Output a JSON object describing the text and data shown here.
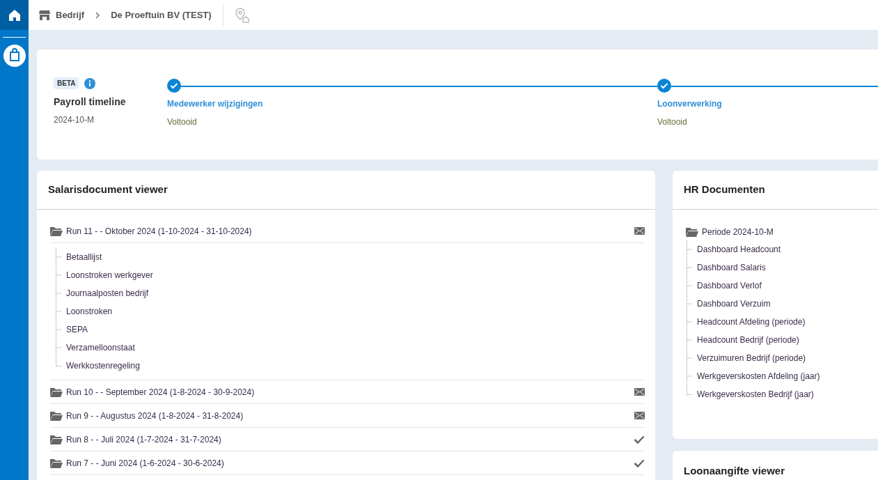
{
  "sidebar": {
    "items": [
      {
        "selected": true
      },
      {
        "selected": false
      }
    ]
  },
  "breadcrumb": [
    "Bedrijf",
    "De Proeftuin BV (TEST)"
  ],
  "timeline": {
    "badge": "BETA",
    "title": "Payroll timeline",
    "period": "2024-10-M",
    "steps": [
      {
        "label": "Medewerker wijzigingen",
        "status": "Voltooid",
        "done": true
      },
      {
        "label": "Loonverwerking",
        "status": "Voltooid",
        "done": true
      }
    ]
  },
  "salary_viewer": {
    "title": "Salarisdocument viewer",
    "runs": [
      {
        "label": "Run 11 - - Oktober 2024 (1-10-2024 - 31-10-2024)",
        "kind": "mail",
        "children": [
          "Betaallijst",
          "Loonstroken werkgever",
          "Journaalposten bedrijf",
          "Loonstroken",
          "SEPA",
          "Verzamelloonstaat",
          "Werkkostenregeling"
        ]
      },
      {
        "label": "Run 10 - - September 2024 (1-8-2024 - 30-9-2024)",
        "kind": "mail"
      },
      {
        "label": "Run 9 - - Augustus 2024 (1-8-2024 - 31-8-2024)",
        "kind": "mail"
      },
      {
        "label": "Run 8 - - Juli 2024 (1-7-2024 - 31-7-2024)",
        "kind": "check"
      },
      {
        "label": "Run 7 - - Juni 2024 (1-6-2024 - 30-6-2024)",
        "kind": "check"
      }
    ]
  },
  "hr_documents": {
    "title": "HR Documenten",
    "folder": "Periode 2024-10-M",
    "children": [
      "Dashboard Headcount",
      "Dashboard Salaris",
      "Dashboard Verlof",
      "Dashboard Verzuim",
      "Headcount Afdeling (periode)",
      "Headcount Bedrijf (periode)",
      "Verzuimuren Bedrijf (periode)",
      "Werkgeverskosten Afdeling (jaar)",
      "Werkgeverskosten Bedrijf (jaar)"
    ]
  },
  "loonaangifte_viewer": {
    "title": "Loonaangifte viewer"
  }
}
